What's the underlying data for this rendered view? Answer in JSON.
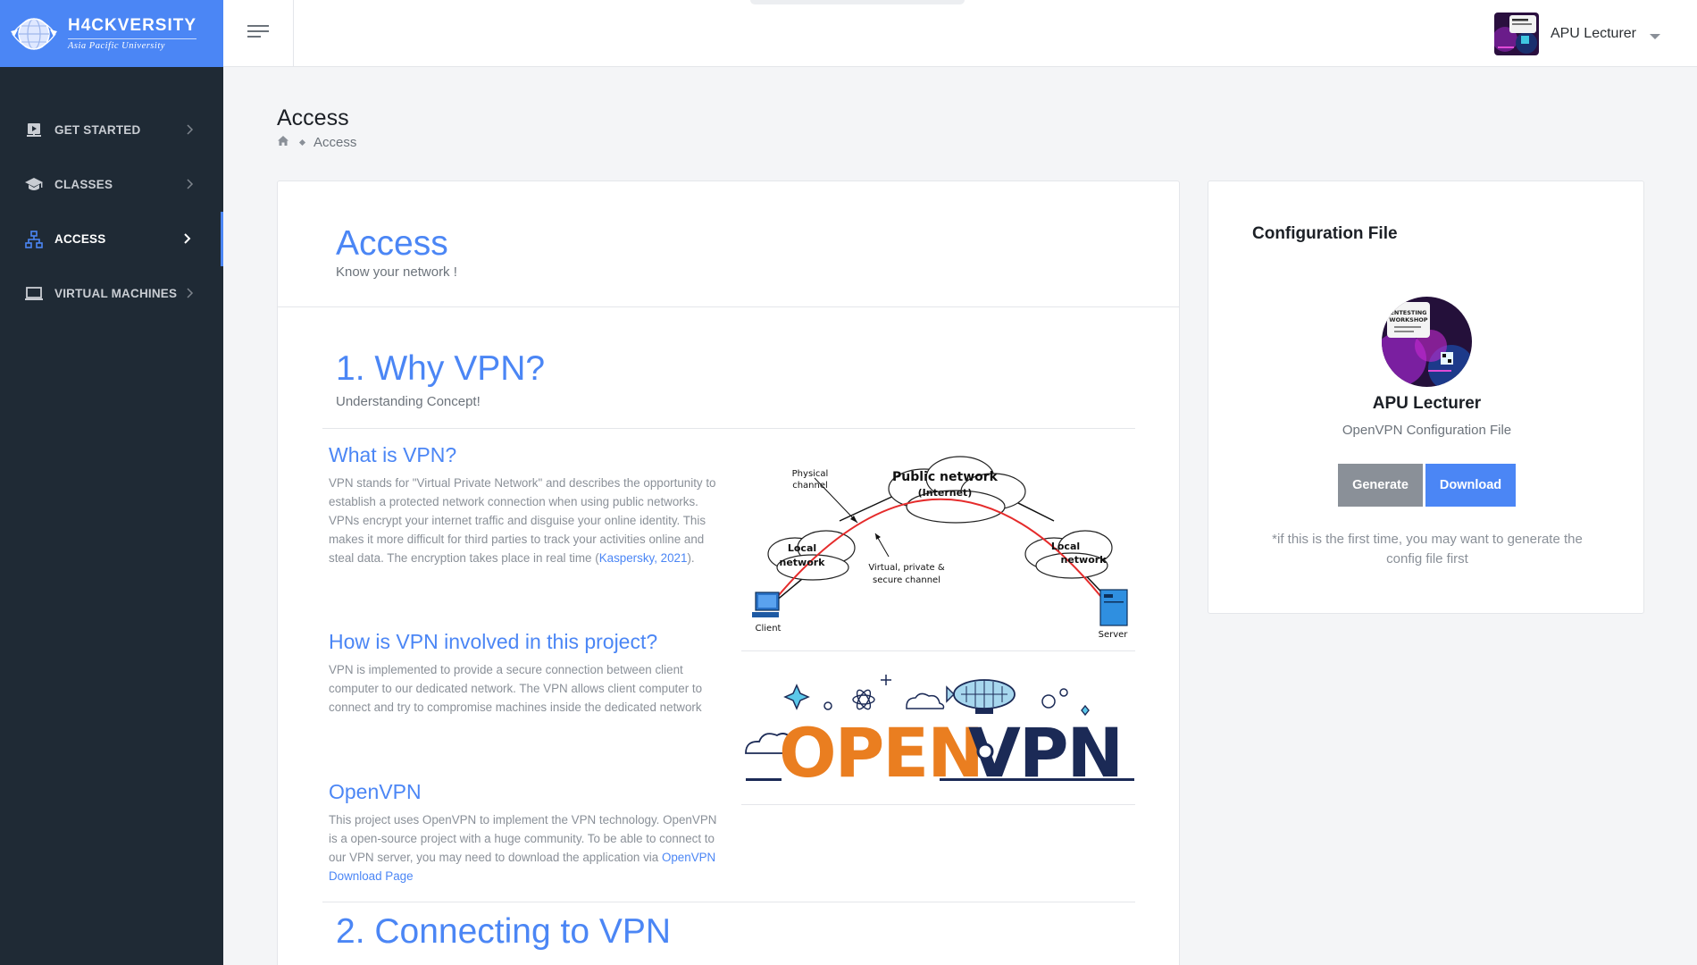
{
  "brand": {
    "name": "H4CKVERSITY",
    "subtitle": "Asia Pacific University"
  },
  "sidebar": {
    "items": [
      {
        "label": "GET STARTED",
        "icon": "presentation-icon",
        "active": false
      },
      {
        "label": "CLASSES",
        "icon": "graduation-cap-icon",
        "active": false
      },
      {
        "label": "ACCESS",
        "icon": "network-icon",
        "active": true
      },
      {
        "label": "VIRTUAL MACHINES",
        "icon": "laptop-icon",
        "active": false
      }
    ]
  },
  "topbar": {
    "user_name": "APU Lecturer"
  },
  "page": {
    "title": "Access",
    "breadcrumb_current": "Access"
  },
  "main": {
    "header_title": "Access",
    "header_subtitle": "Know your network !",
    "section1": {
      "title": "1. Why VPN?",
      "subtitle": "Understanding Concept!"
    },
    "what_is_vpn": {
      "title": "What is VPN?",
      "body": "VPN stands for \"Virtual Private Network\" and describes the opportunity to establish a protected network connection when using public networks. VPNs encrypt your internet traffic and disguise your online identity. This makes it more difficult for third parties to track your activities online and steal data. The encryption takes place in real time (",
      "link": "Kaspersky, 2021",
      "body_end": ")."
    },
    "how_involved": {
      "title": "How is VPN involved in this project?",
      "body": "VPN is implemented to provide a secure connection between client computer to our dedicated network. The VPN allows client computer to connect and try to compromise machines inside the dedicated network"
    },
    "openvpn": {
      "title": "OpenVPN",
      "body": "This project uses OpenVPN to implement the VPN technology. OpenVPN is a open-source project with a huge community. To be able to connect to our VPN server, you may need to download the application via ",
      "link": "OpenVPN Download Page"
    },
    "section2": {
      "title": "2. Connecting to VPN"
    },
    "diagram": {
      "physical_channel_1": "Physical",
      "physical_channel_2": "channel",
      "public_network_1": "Public network",
      "public_network_2": "(Internet)",
      "local_left_1": "Local",
      "local_left_2": "network",
      "local_right_1": "Local",
      "local_right_2": "network",
      "virtual_1": "Virtual, private &",
      "virtual_2": "secure channel",
      "client": "Client",
      "server": "Server"
    },
    "openvpn_logo": {
      "open": "OPEN",
      "vpn": "VPN"
    }
  },
  "config": {
    "title": "Configuration File",
    "name": "APU Lecturer",
    "role": "OpenVPN Configuration File",
    "generate_label": "Generate",
    "download_label": "Download",
    "note": "*if this is the first time, you may want to generate the config file first",
    "avatar_text_1": "ENTESTING",
    "avatar_text_2": "WORKSHOP"
  },
  "colors": {
    "primary": "#4b86f5",
    "sidebar": "#1f2a35",
    "muted": "#8a9098",
    "openvpn_orange": "#ea7e20",
    "openvpn_navy": "#1b2a56"
  }
}
